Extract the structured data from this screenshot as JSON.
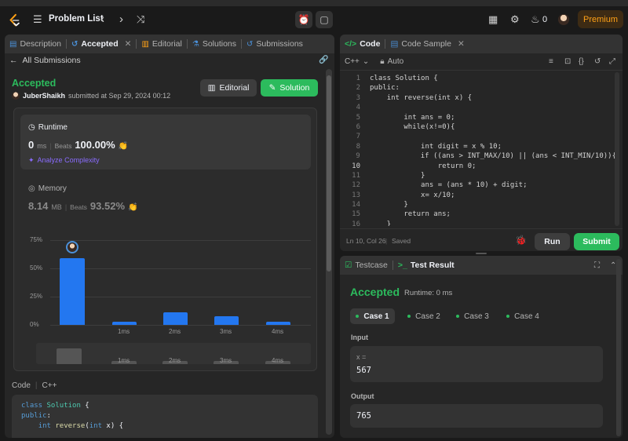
{
  "topbar": {
    "title": "Problem List",
    "streak_count": "0",
    "premium_label": "Premium"
  },
  "left_tabs": [
    {
      "label": "Description"
    },
    {
      "label": "Accepted"
    },
    {
      "label": "Editorial"
    },
    {
      "label": "Solutions"
    },
    {
      "label": "Submissions"
    }
  ],
  "submission": {
    "back_label": "All Submissions",
    "status": "Accepted",
    "user": "JuberShaikh",
    "submitted_text": "submitted at Sep 29, 2024 00:12",
    "editorial_btn": "Editorial",
    "solution_btn": "Solution",
    "runtime_label": "Runtime",
    "runtime_value": "0",
    "runtime_unit": "ms",
    "beats_label": "Beats",
    "runtime_beats": "100.00%",
    "analyze_label": "Analyze Complexity",
    "memory_label": "Memory",
    "memory_value": "8.14",
    "memory_unit": "MB",
    "memory_beats": "93.52%",
    "code_label": "Code",
    "code_lang": "C++"
  },
  "chart_data": {
    "type": "bar",
    "categories": [
      "0ms",
      "1ms",
      "2ms",
      "3ms",
      "4ms"
    ],
    "tick_labels": [
      "",
      "1ms",
      "2ms",
      "3ms",
      "4ms"
    ],
    "values": [
      59,
      2.5,
      11,
      7.5,
      2.5
    ],
    "yticks": [
      "75%",
      "50%",
      "25%",
      "0%"
    ],
    "ylim": [
      0,
      75
    ],
    "color": "#2377f0"
  },
  "code_preview": [
    "class Solution {",
    "public:",
    "    int reverse(int x) {"
  ],
  "editor": {
    "code_tab": "Code",
    "sample_tab": "Code Sample",
    "language": "C++",
    "auto_label": "Auto",
    "status_pos": "Ln 10, Col 26",
    "status_saved": "Saved",
    "run_btn": "Run",
    "submit_btn": "Submit",
    "line_numbers": [
      "1",
      "2",
      "3",
      "4",
      "5",
      "6",
      "7",
      "8",
      "9",
      "10",
      "11",
      "12",
      "13",
      "14",
      "15",
      "16"
    ],
    "lines": [
      "class Solution {",
      "public:",
      "    int reverse(int x) {",
      "",
      "        int ans = 0;",
      "        while(x!=0){",
      "",
      "            int digit = x % 10;",
      "            if ((ans > INT_MAX/10) || (ans < INT_MIN/10)){",
      "                return 0;",
      "            }",
      "            ans = (ans * 10) + digit;",
      "            x= x/10;",
      "        }",
      "        return ans;",
      "    }"
    ]
  },
  "result": {
    "testcase_tab": "Testcase",
    "result_tab": "Test Result",
    "status": "Accepted",
    "runtime_text": "Runtime: 0 ms",
    "cases": [
      "Case 1",
      "Case 2",
      "Case 3",
      "Case 4"
    ],
    "input_label": "Input",
    "input_var": "x =",
    "input_value": "567",
    "output_label": "Output",
    "output_value": "765"
  },
  "colors": {
    "accent_green": "#2cbb5d",
    "premium_orange": "#ffa116",
    "bar_blue": "#2377f0"
  }
}
